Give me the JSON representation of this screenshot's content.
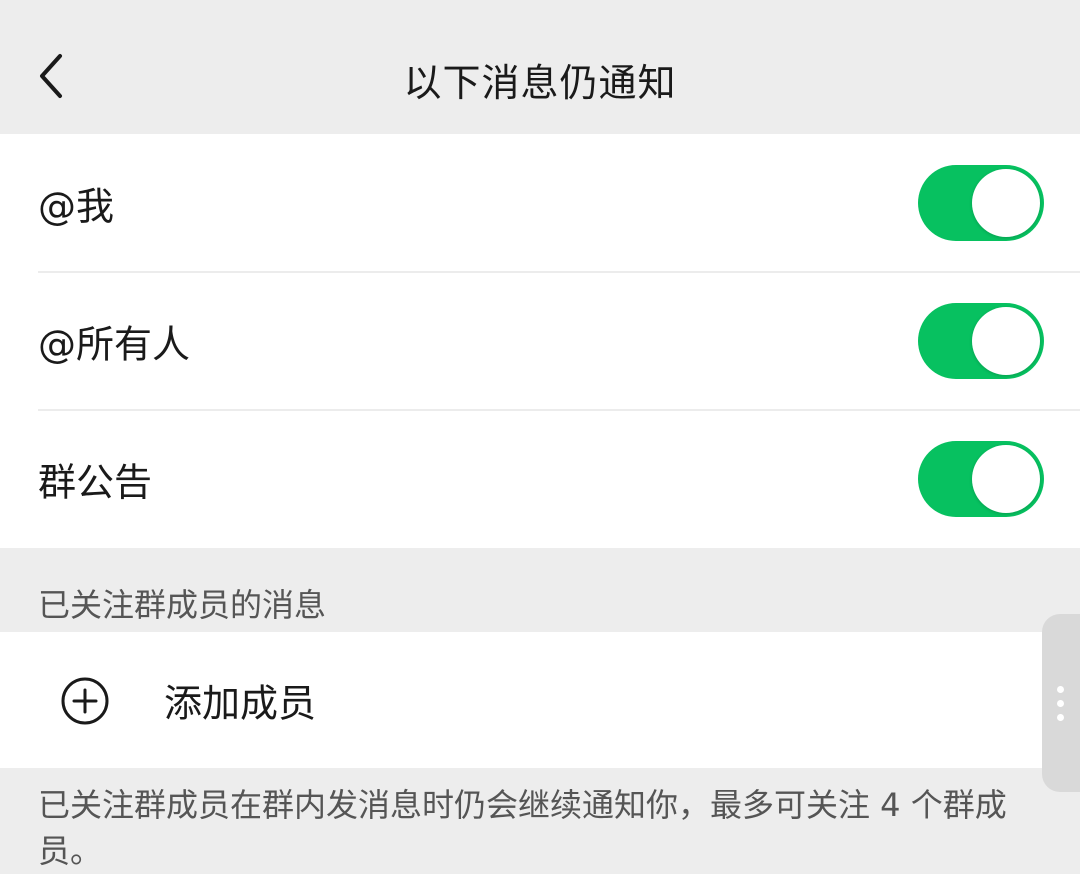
{
  "header": {
    "title": "以下消息仍通知",
    "back_icon": "chevron-left-icon"
  },
  "notify_items": [
    {
      "label": "@我",
      "enabled": true
    },
    {
      "label": "@所有人",
      "enabled": true
    },
    {
      "label": "群公告",
      "enabled": true
    }
  ],
  "followed_section": {
    "title": "已关注群成员的消息",
    "add_label": "添加成员",
    "add_icon": "plus-circle-icon"
  },
  "footer_note": "已关注群成员在群内发消息时仍会继续通知你，最多可关注 4 个群成员。",
  "colors": {
    "toggle_on": "#07c160",
    "background": "#ededed",
    "card": "#ffffff"
  }
}
